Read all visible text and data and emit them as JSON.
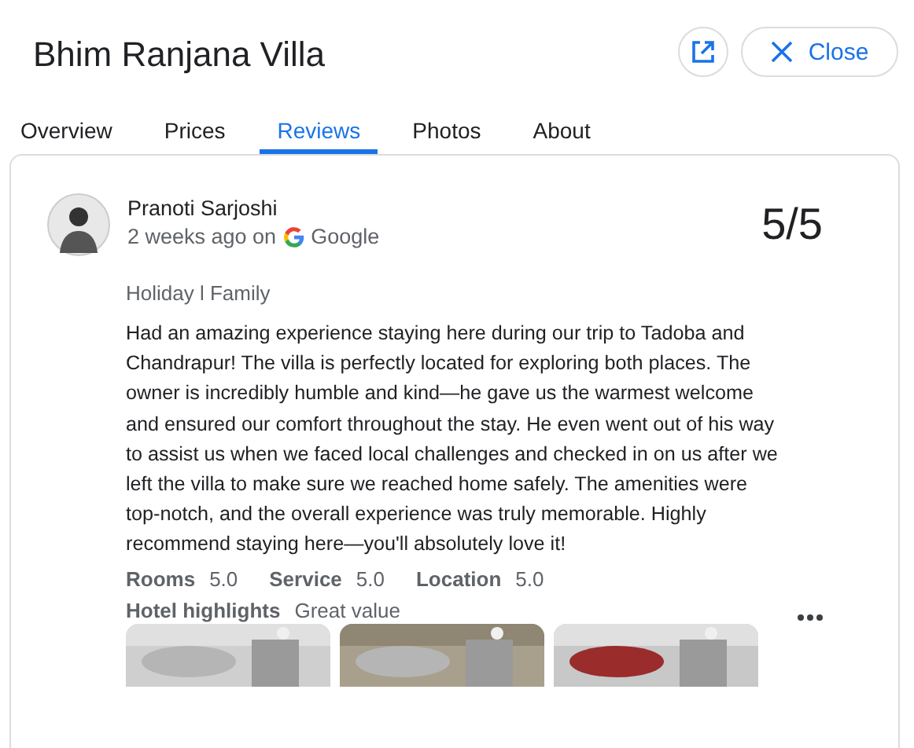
{
  "title": "Bhim Ranjana Villa",
  "header_buttons": {
    "close": "Close"
  },
  "tabs": [
    {
      "label": "Overview",
      "selected": false
    },
    {
      "label": "Prices",
      "selected": false
    },
    {
      "label": "Reviews",
      "selected": true
    },
    {
      "label": "Photos",
      "selected": false
    },
    {
      "label": "About",
      "selected": false
    }
  ],
  "review": {
    "author": "Pranoti Sarjoshi",
    "time": "2 weeks ago on",
    "source": "Google",
    "score": "5/5",
    "trip_type": "Holiday l Family",
    "text": "Had an amazing experience staying here during our trip to Tadoba and Chandrapur! The villa is perfectly located for exploring both places. The owner is incredibly humble and kind—he gave us the warmest welcome and ensured our comfort throughout the stay. He even went out of his way to assist us when we faced local challenges and checked in on us after we left the villa to make sure we reached home safely. The amenities were top-notch, and the overall experience was truly memorable. Highly recommend staying here—you'll absolutely love it!",
    "ratings": [
      {
        "label": "Rooms",
        "value": "5.0"
      },
      {
        "label": "Service",
        "value": "5.0"
      },
      {
        "label": "Location",
        "value": "5.0"
      }
    ],
    "highlights": {
      "label": "Hotel highlights",
      "value": "Great value"
    }
  }
}
